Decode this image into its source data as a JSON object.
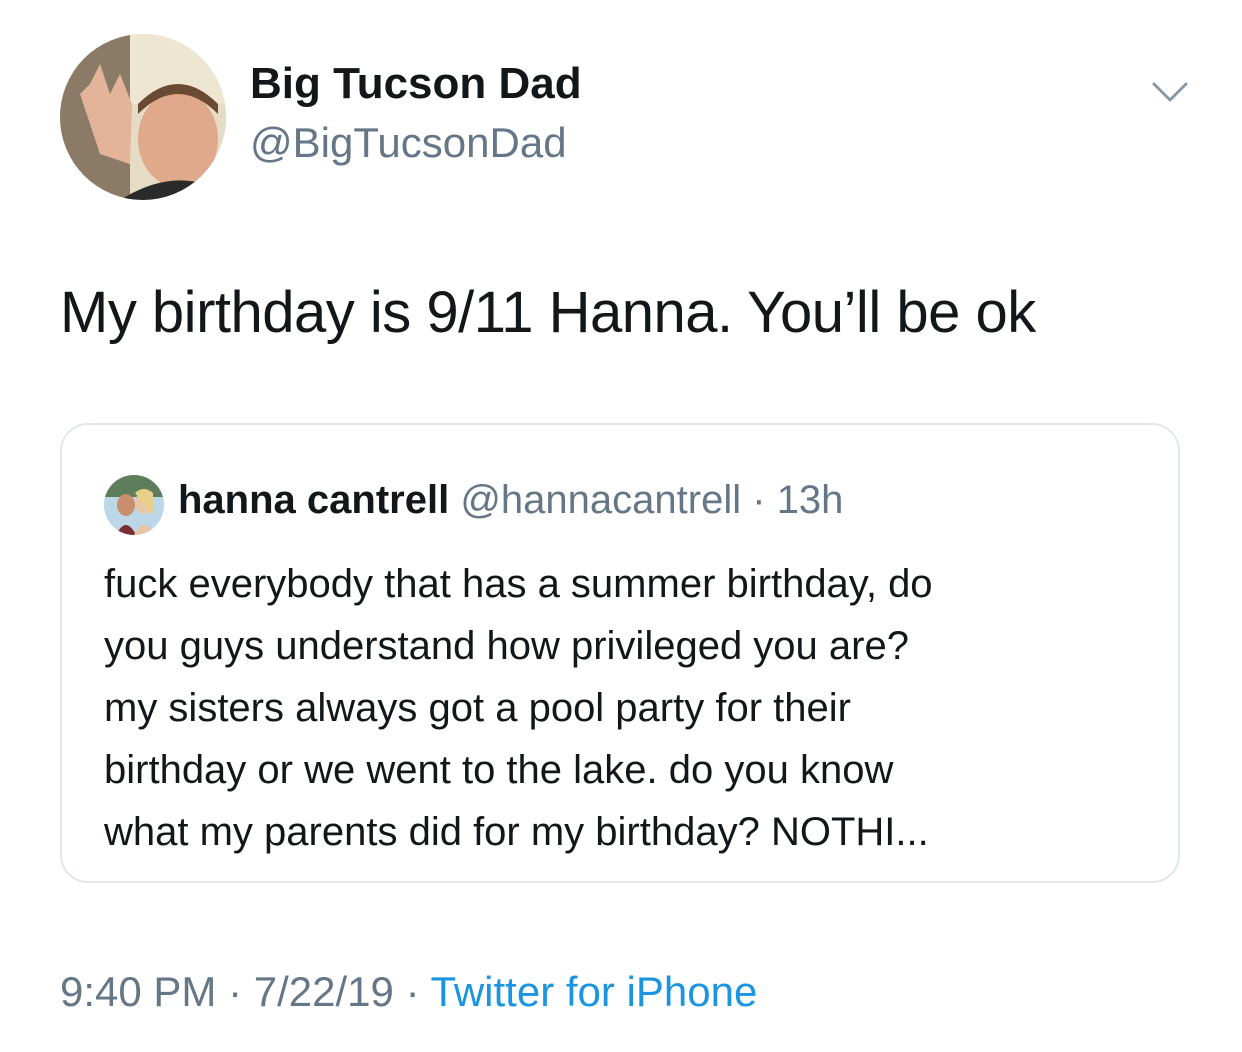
{
  "author": {
    "name": "Big Tucson Dad",
    "handle": "@BigTucsonDad"
  },
  "tweet": {
    "text": "My birthday is 9/11 Hanna. You’ll be ok"
  },
  "quoted_tweet": {
    "name": "hanna cantrell",
    "handle": "@hannacantrell",
    "separator": "·",
    "time": "13h",
    "lines": [
      "fuck everybody that has a summer birthday, do",
      "you guys understand how privileged you are?",
      "my sisters always got a pool party for their",
      "birthday or we went to the lake. do you know",
      "what my parents did for my birthday? NOTHI..."
    ]
  },
  "footer": {
    "time": "9:40 PM",
    "sep1": "·",
    "date": "7/22/19",
    "sep2": "·",
    "source": "Twitter for iPhone"
  },
  "icons": {
    "menu": "chevron-down-icon"
  },
  "colors": {
    "text": "#14171a",
    "secondary": "#657786",
    "link": "#1b95e0",
    "border": "#e1e8ed"
  }
}
